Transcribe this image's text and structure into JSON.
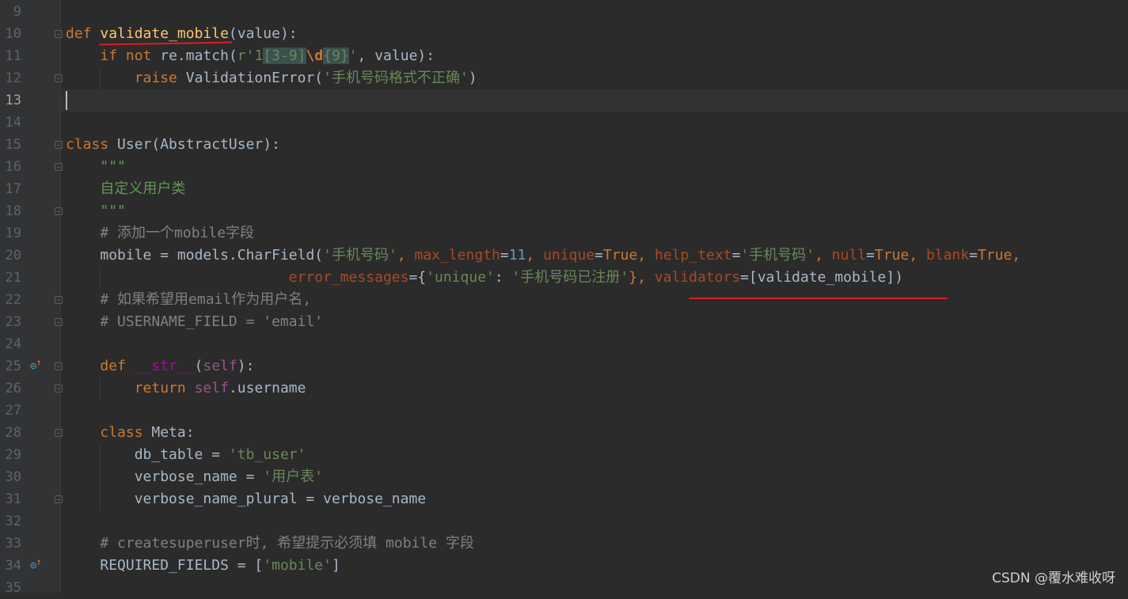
{
  "editor": {
    "line_numbers": [
      "9",
      "10",
      "11",
      "12",
      "13",
      "14",
      "15",
      "16",
      "17",
      "18",
      "19",
      "20",
      "21",
      "22",
      "23",
      "24",
      "25",
      "26",
      "27",
      "28",
      "29",
      "30",
      "31",
      "32",
      "33",
      "34",
      "35"
    ],
    "current_line": "13",
    "lines": {
      "l10": {
        "kw": "def",
        "fn": "validate_mobile",
        "rest1": "(",
        "param": "value",
        "rest2": "):"
      },
      "l11": {
        "kw1": "if",
        "kw2": "not",
        "mid": " re.match(",
        "r": "r'",
        "rx1": "1",
        "rx2": "[3-9]",
        "rx3": "\\d",
        "rx4": "{9}",
        "rq": "'",
        "tail": ", value):"
      },
      "l12": {
        "kw": "raise",
        "mid": " ValidationError(",
        "str": "'手机号码格式不正确'",
        "tail": ")"
      },
      "l15": {
        "kw": "class",
        "tail": " User(AbstractUser):"
      },
      "l16": {
        "doc": "\"\"\""
      },
      "l17": {
        "doc": "自定义用户类"
      },
      "l18": {
        "doc": "\"\"\""
      },
      "l19": {
        "cmt": "# 添加一个mobile字段"
      },
      "l20": {
        "a": "mobile = models.CharField(",
        "s1": "'手机号码'",
        "c1": ", ",
        "k1": "max_length",
        "e1": "=",
        "n1": "11",
        "c2": ", ",
        "k2": "unique",
        "e2": "=",
        "v2": "True",
        "c3": ", ",
        "k3": "help_text",
        "e3": "=",
        "s3": "'手机号码'",
        "c4": ", ",
        "k4": "null",
        "e4": "=",
        "v4": "True",
        "c5": ", ",
        "k5": "blank",
        "e5": "=",
        "v5": "True",
        "c6": ","
      },
      "l21": {
        "k1": "error_messages",
        "e1": "={",
        "s1": "'unique'",
        "c1": ": ",
        "s2": "'手机号码已注册'",
        "c2": "}, ",
        "k2": "validators",
        "e2": "=[validate_mobile])"
      },
      "l22": {
        "cmt": "# 如果希望用email作为用户名,"
      },
      "l23": {
        "cmt": "# USERNAME_FIELD = 'email'"
      },
      "l25": {
        "kw": "def",
        "sp": " ",
        "fn": "__str__",
        "p1": "(",
        "self": "self",
        "p2": "):"
      },
      "l26": {
        "kw": "return",
        "sp": " ",
        "self": "self",
        "tail": ".username"
      },
      "l28": {
        "kw": "class",
        "tail": " Meta:"
      },
      "l29": {
        "a": "db_table = ",
        "s": "'tb_user'"
      },
      "l30": {
        "a": "verbose_name = ",
        "s": "'用户表'"
      },
      "l31": {
        "a": "verbose_name_plural = verbose_name"
      },
      "l33": {
        "cmt": "# createsuperuser时, 希望提示必须填 mobile 字段"
      },
      "l34": {
        "a": "REQUIRED_FIELDS = [",
        "s": "'mobile'",
        "b": "]"
      }
    }
  },
  "gutter_icons": {
    "override_mark": "override-icon"
  },
  "watermark": "CSDN @覆水难收呀",
  "colors": {
    "background": "#2b2b2b",
    "keyword": "#cc7832",
    "string": "#6a8759",
    "function": "#ffc66d",
    "underline": "#e01b24"
  }
}
